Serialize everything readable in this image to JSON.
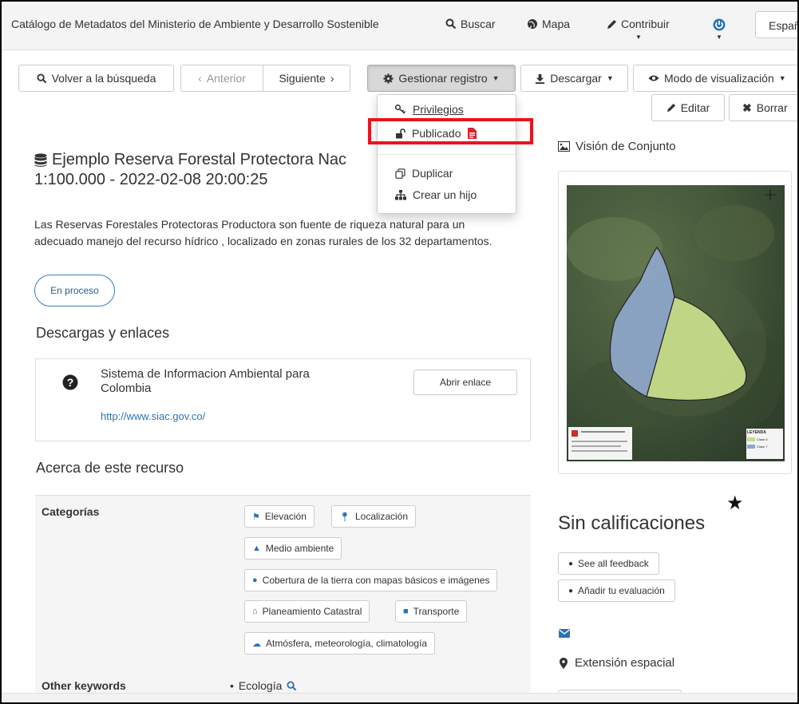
{
  "navbar": {
    "title": "Catálogo de Metadatos del Ministerio de Ambiente y Desarrollo Sostenible",
    "search": "Buscar",
    "map": "Mapa",
    "contribute": "Contribuir",
    "language": "Español"
  },
  "toolbar": {
    "back": "Volver a la búsqueda",
    "previous": "Anterior",
    "next": "Siguiente",
    "manage": "Gestionar registro",
    "download": "Descargar",
    "view_mode": "Modo de visualización",
    "edit": "Editar",
    "delete": "Borrar"
  },
  "manage_menu": {
    "privileges": "Privilegios",
    "published": "Publicado",
    "duplicate": "Duplicar",
    "create_child": "Crear un hijo"
  },
  "record": {
    "title_line1": "Ejemplo Reserva Forestal Protectora Nac",
    "title_line2": "1:100.000 - 2022-02-08 20:00:25",
    "abstract": "Las Reservas Forestales Protectoras Productora son fuente de riqueza natural para un adecuado manejo del recurso hídrico , localizado en zonas rurales de los 32 departamentos.",
    "status": "En proceso"
  },
  "downloads": {
    "heading": "Descargas y enlaces",
    "link_title": "Sistema de Informacion Ambiental para Colombia",
    "link_url": "http://www.siac.gov.co/",
    "open_link": "Abrir enlace"
  },
  "about": {
    "heading": "Acerca de este recurso",
    "categories_label": "Categorías",
    "categories": [
      "Elevación",
      "Localización",
      "Medio ambiente",
      "Cobertura de la tierra con mapas básicos e imágenes",
      "Planeamiento Catastral",
      "Transporte",
      "Atmósfera, meteorología, climatología"
    ],
    "other_keywords_label": "Other keywords",
    "keywords": [
      "Ecología"
    ]
  },
  "sidebar": {
    "overview": "Visión de Conjunto",
    "map_legend_title": "LEYENDA",
    "map_legend_items": [
      "Clase 6",
      "Clase 7"
    ],
    "ratings": "Sin calificaciones",
    "see_feedback": "See all feedback",
    "add_review": "Añadir tu evaluación",
    "spatial_extent": "Extensión espacial"
  },
  "colors": {
    "highlight": "#e8141e",
    "link": "#2a73b8",
    "polygon_a": "#8ea6c8",
    "polygon_b": "#c7dc8a"
  }
}
